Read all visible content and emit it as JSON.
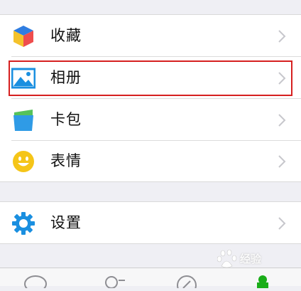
{
  "menu": {
    "group1": [
      {
        "label": "收藏",
        "icon": "favorites-cube-icon"
      },
      {
        "label": "相册",
        "icon": "album-picture-icon"
      },
      {
        "label": "卡包",
        "icon": "card-wallet-icon"
      },
      {
        "label": "表情",
        "icon": "sticker-smiley-icon"
      }
    ],
    "group2": [
      {
        "label": "设置",
        "icon": "settings-gear-icon"
      }
    ]
  },
  "highlight": {
    "target": "相册",
    "color": "#d62020"
  },
  "tabbar": {
    "tabs": [
      "chats-tab-icon",
      "contacts-tab-icon",
      "discover-tab-icon",
      "me-tab-icon"
    ]
  },
  "watermark": {
    "text": "经验"
  },
  "colors": {
    "background": "#efeff4",
    "accent_green": "#1aad19",
    "settings_blue": "#1a8fe0"
  }
}
